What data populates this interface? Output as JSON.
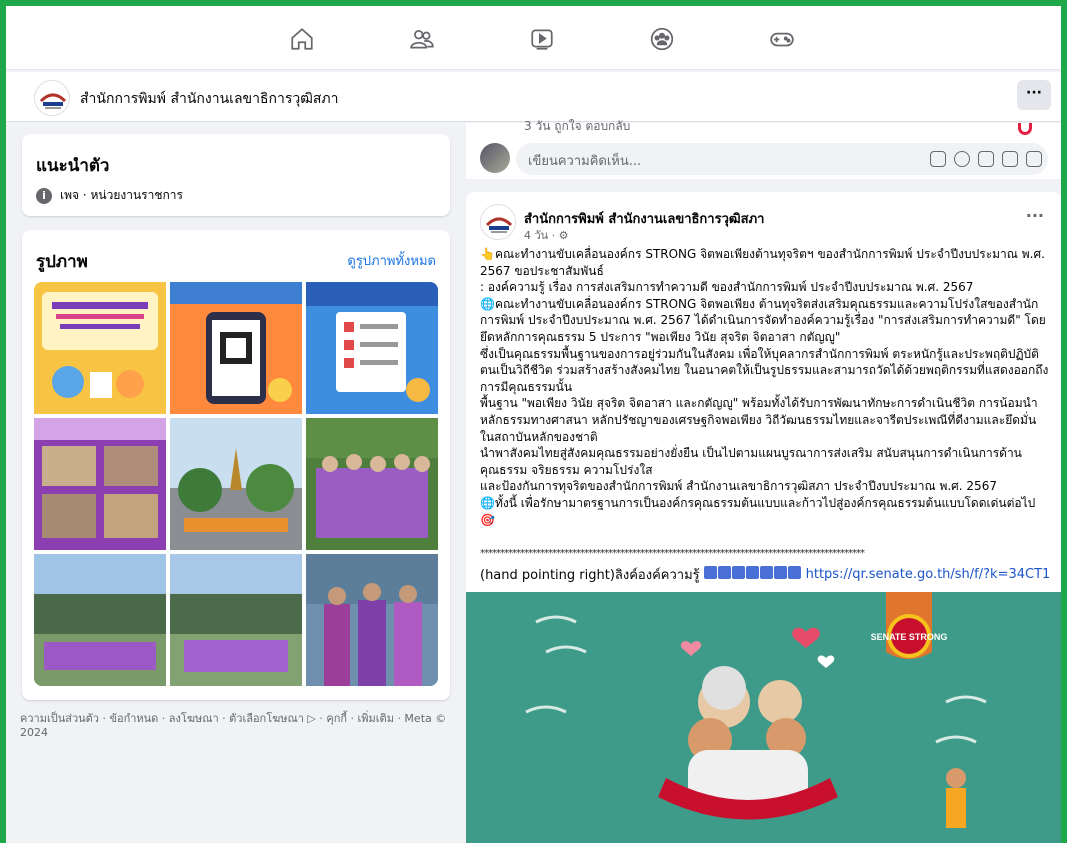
{
  "nav": {
    "icons": [
      "home-icon",
      "friends-icon",
      "watch-icon",
      "groups-icon",
      "gaming-icon"
    ]
  },
  "page": {
    "name": "สำนักการพิมพ์ สำนักงานเลขาธิการวุฒิสภา",
    "more": "···"
  },
  "intro": {
    "title": "แนะนำตัว",
    "category": "เพจ · หน่วยงานราชการ"
  },
  "photos": {
    "title": "รูปภาพ",
    "see_all": "ดูรูปภาพทั้งหมด"
  },
  "footer": {
    "text": "ความเป็นส่วนตัว · ข้อกำหนด · ลงโฆษณา · ตัวเลือกโฆษณา ▷ · คุกกี้ · เพิ่มเติม · Meta © 2024"
  },
  "comment": {
    "meta": "3 วัน   ถูกใจ   ตอบกลับ",
    "placeholder": "เขียนความคิดเห็น..."
  },
  "post": {
    "author": "สำนักการพิมพ์ สำนักงานเลขาธิการวุฒิสภา",
    "time": "4 วัน · ⚙",
    "more": "···",
    "lines": [
      "👆คณะทำงานขับเคลื่อนองค์กร STRONG จิตพอเพียงต้านทุจริตฯ ของสำนักการพิมพ์ ประจำปีงบประมาณ พ.ศ. 2567 ขอประชาสัมพันธ์",
      " : องค์ความรู้ เรื่อง การส่งเสริมการทำความดี ของสำนักการพิมพ์ ประจำปีงบประมาณ พ.ศ. 2567",
      "🌐คณะทำงานขับเคลื่อนองค์กร STRONG จิตพอเพียง ต้านทุจริตส่งเสริมคุณธรรมและความโปร่งใสของสำนักการพิมพ์ ประจำปีงบประมาณ พ.ศ. 2567 ได้ดำเนินการจัดทำองค์ความรู้เรื่อง \"การส่งเสริมการทำความดี\" โดยยึดหลักการคุณธรรม 5 ประการ \"พอเพียง วินัย สุจริต จิตอาสา กตัญญู\"",
      "ซึ่งเป็นคุณธรรมพื้นฐานของการอยู่ร่วมกันในสังคม เพื่อให้บุคลากรสำนักการพิมพ์ ตระหนักรู้และประพฤติปฏิบัติตนเป็นวิถีชีวิต ร่วมสร้างสร้างสังคมไทย ในอนาคตให้เป็นรูปธรรมและสามารถวัดได้ด้วยพฤติกรรมที่แสดงออกถึงการมีคุณธรรมนั้น",
      "พื้นฐาน \"พอเพียง วินัย สุจริต จิตอาสา และกตัญญู\" พร้อมทั้งได้รับการพัฒนาทักษะการดำเนินชีวิต การน้อมนำหลักธรรมทางศาสนา หลักปรัชญาของเศรษฐกิจพอเพียง วิถีวัฒนธรรมไทยและจารีตประเพณีที่ดีงามและยึดมั่นในสถาบันหลักของชาติ",
      "นำพาสังคมไทยสู่สังคมคุณธรรมอย่างยั่งยืน เป็นไปตามแผนบูรณาการส่งเสริม สนับสนุนการดำเนินการด้านคุณธรรม จริยธรรม ความโปร่งใส",
      "และป้องกันการทุจริตของสำนักการพิมพ์ สำนักงานเลขาธิการวุฒิสภา ประจำปีงบประมาณ พ.ศ. 2567",
      "🌐ทั้งนี้ เพื่อรักษามาตรฐานการเป็นองค์กรคุณธรรมต้นแบบและก้าวไปสู่องค์กรคุณธรรมต้นแบบโดดเด่นต่อไป🎯"
    ],
    "stars": "************************************************************************************************",
    "link_prefix": "(hand pointing right)ลิงค์องค์ความรู้",
    "link_url": "https://qr.senate.go.th/sh/f/?k=34CT1"
  },
  "poster": {
    "badge": "SENATE STRONG"
  }
}
